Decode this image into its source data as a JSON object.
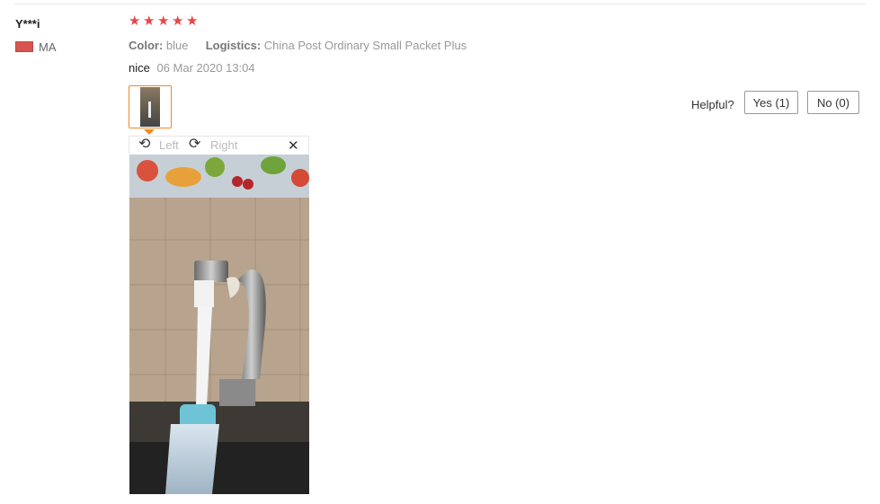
{
  "review": {
    "user": "Y***i",
    "country": "MA",
    "rating": 5,
    "attributes": {
      "color_key": "Color:",
      "color_value": "blue",
      "logistics_key": "Logistics:",
      "logistics_value": "China Post Ordinary Small Packet Plus"
    },
    "text": "nice",
    "date": "06 Mar 2020 13:04"
  },
  "viewer": {
    "rotate_left_label": "Left",
    "rotate_right_label": "Right",
    "icons": [
      "rotate-left-icon",
      "rotate-right-icon",
      "close-icon"
    ]
  },
  "helpful": {
    "label": "Helpful?",
    "yes_label": "Yes (1)",
    "no_label": "No (0)"
  },
  "colors": {
    "star": "#e8454a",
    "thumb_border": "#f08a24"
  }
}
